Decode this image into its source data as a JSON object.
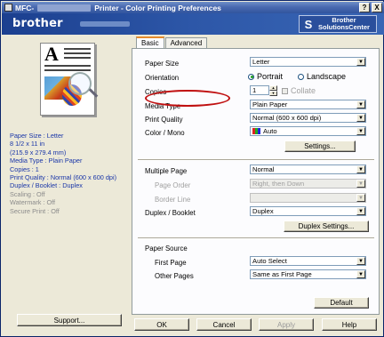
{
  "window": {
    "title_prefix": "MFC-",
    "title": "Printer - Color Printing Preferences",
    "help_button": "?",
    "close_button": "X"
  },
  "banner": {
    "brand": "brother",
    "solutions_line1": "Brother",
    "solutions_line2": "SolutionsCenter"
  },
  "summary": [
    {
      "text": "Paper Size : Letter",
      "dim": false
    },
    {
      "text": "8 1/2 x 11 in",
      "dim": false
    },
    {
      "text": "(215.9 x 279.4 mm)",
      "dim": false
    },
    {
      "text": "Media Type : Plain Paper",
      "dim": false
    },
    {
      "text": "Copies : 1",
      "dim": false
    },
    {
      "text": "Print Quality : Normal (600 x 600 dpi)",
      "dim": false
    },
    {
      "text": "Duplex / Booklet : Duplex",
      "dim": false
    },
    {
      "text": "Scaling : Off",
      "dim": true
    },
    {
      "text": "Watermark : Off",
      "dim": true
    },
    {
      "text": "Secure Print : Off",
      "dim": true
    }
  ],
  "support_button": "Support...",
  "tabs": [
    {
      "label": "Basic",
      "active": true
    },
    {
      "label": "Advanced",
      "active": false
    }
  ],
  "fields": {
    "paper_size": {
      "label": "Paper Size",
      "value": "Letter"
    },
    "orientation": {
      "label": "Orientation",
      "portrait": "Portrait",
      "landscape": "Landscape",
      "selected": "Portrait"
    },
    "copies": {
      "label": "Copies",
      "value": "1",
      "collate": "Collate"
    },
    "media_type": {
      "label": "Media Type",
      "value": "Plain Paper"
    },
    "print_quality": {
      "label": "Print Quality",
      "value": "Normal (600 x 600 dpi)"
    },
    "color_mono": {
      "label": "Color / Mono",
      "value": "Auto"
    },
    "settings_button": "Settings...",
    "multiple_page": {
      "label": "Multiple Page",
      "value": "Normal"
    },
    "page_order": {
      "label": "Page Order",
      "value": "Right, then Down"
    },
    "border_line": {
      "label": "Border Line",
      "value": ""
    },
    "duplex_booklet": {
      "label": "Duplex / Booklet",
      "value": "Duplex"
    },
    "duplex_settings_button": "Duplex Settings...",
    "paper_source": {
      "label": "Paper Source"
    },
    "first_page": {
      "label": "First Page",
      "value": "Auto Select"
    },
    "other_pages": {
      "label": "Other Pages",
      "value": "Same as First Page"
    },
    "default_button": "Default"
  },
  "buttons": {
    "ok": "OK",
    "cancel": "Cancel",
    "apply": "Apply",
    "help": "Help"
  },
  "colors": {
    "title_bar": "#31549e",
    "banner": "#2d57a8",
    "summary_text": "#1a36a8",
    "highlight": "#c01010"
  }
}
